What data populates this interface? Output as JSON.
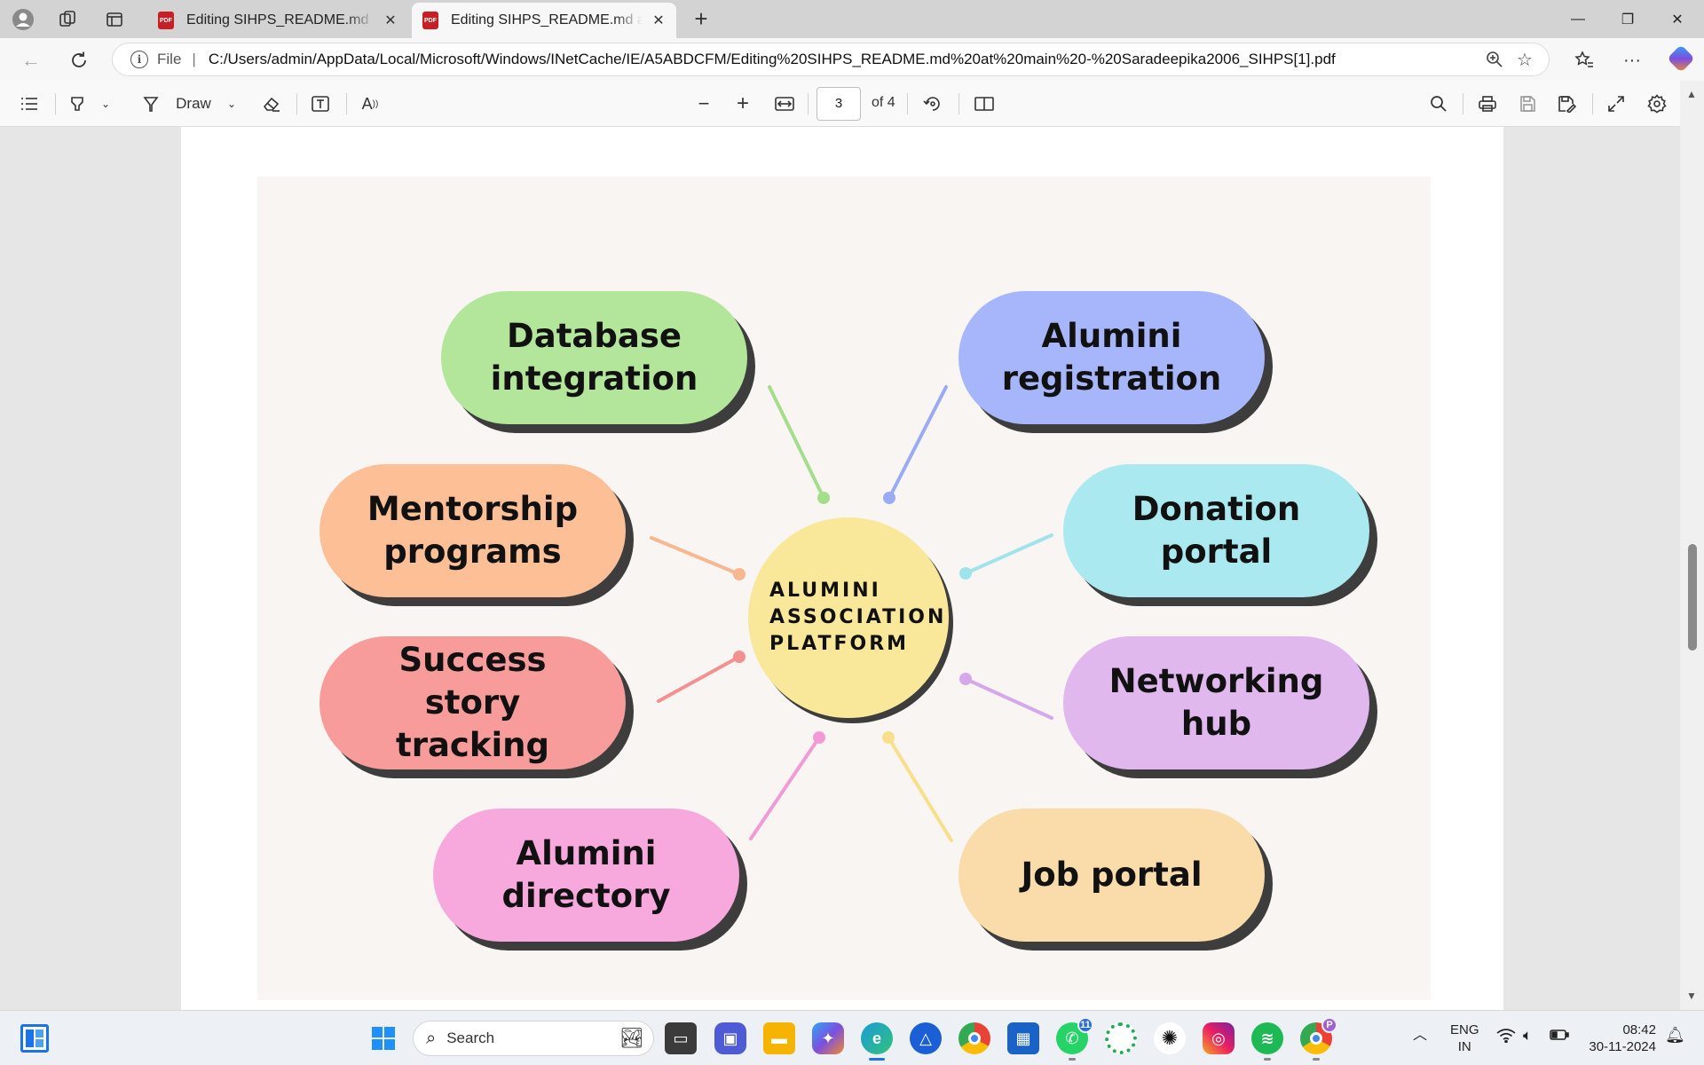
{
  "browser": {
    "tabs": [
      {
        "title": "Editing SIHPS_README.md at main",
        "close": "✕",
        "icon": "pdf-icon"
      },
      {
        "title": "Editing SIHPS_README.md at main",
        "close": "✕",
        "icon": "pdf-icon"
      }
    ],
    "new_tab": "+",
    "window_controls": {
      "minimize": "—",
      "restore": "❐",
      "close": "✕"
    },
    "address": {
      "scheme_label": "File",
      "separator": "|",
      "url": "C:/Users/admin/AppData/Local/Microsoft/Windows/INetCache/IE/A5ABDCFM/Editing%20SIHPS_README.md%20at%20main%20-%20Saradeepika2006_SIHPS[1].pdf"
    }
  },
  "pdf_toolbar": {
    "draw_label": "Draw",
    "current_page": "3",
    "page_of": "of 4"
  },
  "diagram": {
    "hub": {
      "label": "ALUMINI ASSOCIATION PLATFORM",
      "color": "#f9e79a"
    },
    "nodes": [
      {
        "label": "Database integration",
        "color": "#b3e59a",
        "connector": "#a4de8a"
      },
      {
        "label": "Alumini registration",
        "color": "#a7b6fb",
        "connector": "#9aaaf6"
      },
      {
        "label": "Mentorship programs",
        "color": "#fdbf96",
        "connector": "#f8b78e"
      },
      {
        "label": "Donation portal",
        "color": "#a9e9ef",
        "connector": "#9fe4ec"
      },
      {
        "label": "Success story tracking",
        "color": "#f79b9b",
        "connector": "#f59090"
      },
      {
        "label": "Networking hub",
        "color": "#e0b8ee",
        "connector": "#d6a8ea"
      },
      {
        "label": "Alumini directory",
        "color": "#f7a8dd",
        "connector": "#f39ad6"
      },
      {
        "label": "Job portal",
        "color": "#f9dcaa",
        "connector": "#f8e08a"
      }
    ]
  },
  "taskbar": {
    "search_placeholder": "Search",
    "whatsapp_badge": "11",
    "profile_badge": "P",
    "language": "ENG",
    "region": "IN",
    "time": "08:42",
    "date": "30-11-2024"
  }
}
